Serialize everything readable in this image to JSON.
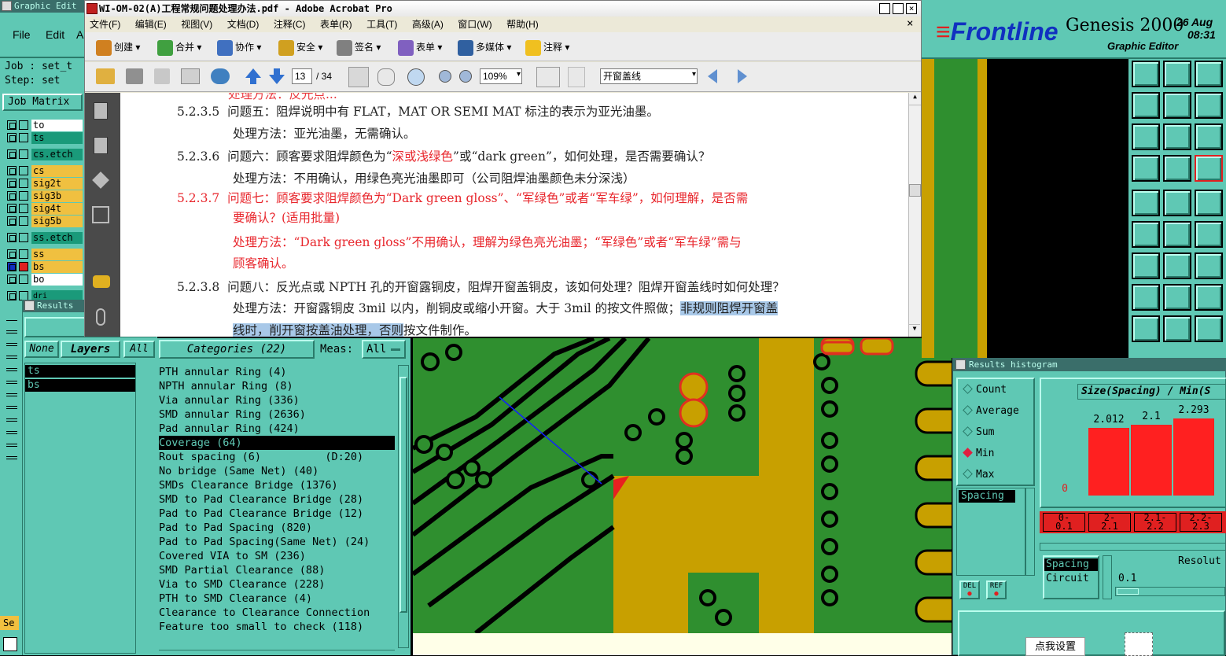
{
  "genesis_left": {
    "window_title": "Graphic Edit",
    "menu": [
      "File",
      "Edit",
      "A"
    ],
    "job_label": "Job : set_t",
    "step_label": "Step: set",
    "job_matrix_button": "Job Matrix",
    "layers": [
      "to",
      "ts",
      "cs.etch",
      "cs",
      "sig2t",
      "sig3b",
      "sig4t",
      "sig5b",
      "ss.etch",
      "ss",
      "bs",
      "bo",
      "dri"
    ],
    "results_title": "Results",
    "none_button": "None",
    "layers_button": "Layers",
    "all_button": "All",
    "selected_layers": [
      "ts",
      "bs"
    ],
    "bottom_label": "Se"
  },
  "acrobat": {
    "title": "WI-OM-02(A)工程常规问题处理办法.pdf - Adobe Acrobat Pro",
    "close": "×",
    "menu": [
      "文件(F)",
      "编辑(E)",
      "视图(V)",
      "文档(D)",
      "注释(C)",
      "表单(R)",
      "工具(T)",
      "高级(A)",
      "窗口(W)",
      "帮助(H)"
    ],
    "toolbar1": [
      "创建",
      "合并",
      "协作",
      "安全",
      "签名",
      "表单",
      "多媒体",
      "注释"
    ],
    "page_current": "13",
    "page_total": "/ 34",
    "zoom": "109%",
    "find_value": "开窗盖线",
    "doc_lines": [
      {
        "num": "5.2.3.5",
        "text": "问题五：阻焊说明中有 FLAT，MAT OR SEMI MAT 标注的表示为亚光油墨。"
      },
      {
        "text": "处理方法：亚光油墨，无需确认。"
      },
      {
        "num": "5.2.3.6",
        "text_a": "问题六：顾客要求阻焊颜色为“",
        "text_red": "深或浅绿色",
        "text_b": "”或“dark green”，如何处理，是否需要确认？"
      },
      {
        "text": "处理方法：不用确认，用绿色亮光油墨即可（公司阻焊油墨颜色未分深浅）"
      },
      {
        "num": "5.2.3.7",
        "text": "问题七：顾客要求阻焊颜色为“Dark green gloss”、“军绿色”或者“军车绿”，如何理解，是否需"
      },
      {
        "text": "要确认？(适用批量)"
      },
      {
        "text": "处理方法：“Dark green gloss”不用确认，理解为绿色亮光油墨；“军绿色”或者“军车绿”需与"
      },
      {
        "text": "顾客确认。"
      },
      {
        "num": "5.2.3.8",
        "text": "问题八：反光点或 NPTH 孔的开窗露铜皮，阻焊开窗盖铜皮，该如何处理？阻焊开窗盖线时如何处理？"
      },
      {
        "text_a": "处理方法：开窗露铜皮 3mil 以内，削铜皮或缩小开窗。大于 3mil 的按文件照做；",
        "text_hl": "非规则阻焊开窗盖"
      },
      {
        "text_hl": "线时，削开窗按盖油处理，否则",
        "text_b": "按文件制作。"
      }
    ]
  },
  "categories": {
    "title": "Categories (22)",
    "meas_label": "Meas:",
    "meas_value": "All",
    "items": [
      "PTH annular Ring (4)",
      "NPTH annular Ring (8)",
      "Via annular Ring (336)",
      "SMD annular Ring (2636)",
      "Pad annular Ring (424)",
      "Coverage (64)",
      "Rout spacing (6)          (D:20)",
      "No bridge (Same Net) (40)",
      "SMDs Clearance Bridge (1376)",
      "SMD to Pad Clearance Bridge (28)",
      "Pad to Pad Clearance Bridge (12)",
      "Pad to Pad Spacing (820)",
      "Pad to Pad Spacing(Same Net) (24)",
      "Covered VIA to SM (236)",
      "SMD Partial Clearance (88)",
      "Via to SMD Clearance (228)",
      "PTH to SMD Clearance (4)",
      "Clearance to Clearance Connection",
      "Feature too small to check (118)"
    ],
    "selected_index": 5
  },
  "genesis_right": {
    "brand": "Frontline",
    "product": "Genesis 2000",
    "date": "26 Aug",
    "time": "08:31",
    "subtitle": "Graphic Editor"
  },
  "histogram": {
    "title": "Results histogram",
    "options": [
      "Count",
      "Average",
      "Sum",
      "Min",
      "Max"
    ],
    "selected_option": "Min",
    "header": "Size(Spacing) / Min(S",
    "bars": [
      {
        "label": "0",
        "value": 0,
        "range": "0-\n0.1"
      },
      {
        "label": "2.012",
        "value": 2.012,
        "range": "2-\n2.1"
      },
      {
        "label": "2.1",
        "value": 2.1,
        "range": "2.1-\n2.2"
      },
      {
        "label": "2.293",
        "value": 2.293,
        "range": "2.2-\n2.3"
      }
    ],
    "list_item": "Spacing",
    "del_button": "DEL",
    "ref_button": "REF",
    "type_selected": "Spacing",
    "type_other": "Circuit",
    "resolution_label": "Resolut",
    "resolution_value": "0.1",
    "chinese_button": "点我设置"
  },
  "colors": {
    "teal": "#5fc8b4",
    "pcb_green": "#2f8f2f",
    "copper_gold": "#c8a000",
    "pad_red": "#e03020",
    "bar_red": "#ff2020"
  }
}
